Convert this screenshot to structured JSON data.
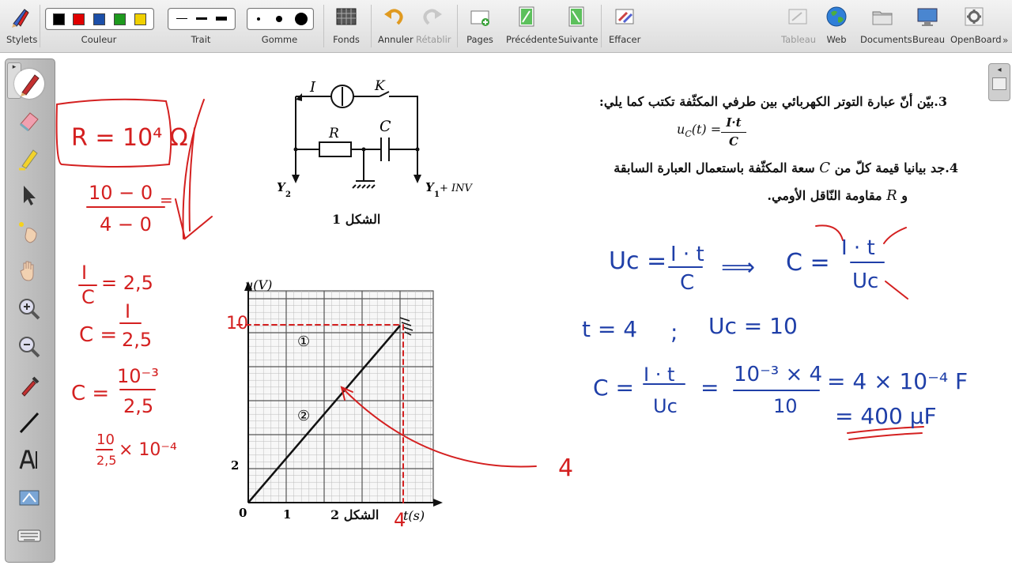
{
  "toolbar": {
    "stylets": "Stylets",
    "couleur": "Couleur",
    "trait": "Trait",
    "gomme": "Gomme",
    "fonds": "Fonds",
    "annuler": "Annuler",
    "retablir": "Rétablir",
    "pages": "Pages",
    "precedente": "Précédente",
    "suivante": "Suivante",
    "effacer": "Effacer",
    "tableau": "Tableau",
    "web": "Web",
    "documents": "Documents",
    "bureau": "Bureau",
    "openboard": "OpenBoard",
    "colors": [
      "#000000",
      "#e00000",
      "#1c4fa8",
      "#1e9a1e",
      "#f0d000"
    ]
  },
  "dock": {
    "tools": [
      "pen-icon",
      "eraser-icon",
      "marker-icon",
      "selector-icon",
      "laser-pointer-icon",
      "hand-icon",
      "zoom-in-icon",
      "zoom-out-icon",
      "color-picker-icon",
      "line-icon",
      "text-icon",
      "capture-icon",
      "keyboard-icon"
    ]
  },
  "doc": {
    "q3": "3.بيّن أنّ عبارة التوتر الكهربائي بين طرفي المكثّفة تكتب كما يلي:",
    "q3_formula_lhs": "u",
    "q3_formula_sub": "C",
    "q3_formula_t": "(t) =",
    "q3_formula_num": "I·t",
    "q3_formula_den": "C",
    "q4_line1": "4.جد بيانيا قيمة كلّ من",
    "q4_c": "C",
    "q4_line1b": "سعة المكثّفة باستعمال العبارة السابقة",
    "q4_line2a": "و",
    "q4_r": "R",
    "q4_line2b": "مقاومة النّاقل الأومي.",
    "fig1_caption": "الشكل 1",
    "fig2_caption": "الشكل 2",
    "circuit": {
      "I": "I",
      "K": "K",
      "R": "R",
      "C": "C",
      "Y2": "Y",
      "Y2sub": "2",
      "Y1": "Y",
      "Y1sub": "1",
      "inv": "+ INV"
    },
    "graph": {
      "y_axis": "u(V)",
      "x_axis": "t(s)",
      "origin": "0",
      "x_tick_1": "1",
      "y_tick_2": "2",
      "curve1": "①",
      "curve2": "②"
    }
  },
  "annotations": {
    "red_box": "R = 10⁴ Ω",
    "red_frac_num": "10 − 0",
    "red_frac_den": "4 − 0",
    "red_frac_eq": "=",
    "red_I_over_C": "I",
    "red_I_over_C_den": "C",
    "red_eq_25": "= 2,5",
    "red_C_eq": "C =",
    "red_I": "I",
    "red_25": "2,5",
    "red_C_eq2": "C =",
    "red_10m3": "10⁻³",
    "red_25b": "2,5",
    "red_10": "10",
    "red_25c": "2,5",
    "red_times": "× 10⁻⁴",
    "red_10_graph": "10",
    "red_4_graph": "4",
    "red_4_right": "4",
    "blue_uc": "Uc =",
    "blue_It": "I · t",
    "blue_C": "C",
    "blue_arrow": "⟹",
    "blue_C_eq": "C =",
    "blue_It2": "I · t",
    "blue_Uc": "Uc",
    "blue_t4": "t = 4",
    "blue_semicolon": ";",
    "blue_uc10": "Uc = 10",
    "blue_C3": "C =",
    "blue_It3": "I · t",
    "blue_Uc3": "Uc",
    "blue_eq": "=",
    "blue_num": "10⁻³ × 4",
    "blue_den": "10",
    "blue_res1": "= 4 × 10⁻⁴ F",
    "blue_res2": "= 400 µF"
  }
}
